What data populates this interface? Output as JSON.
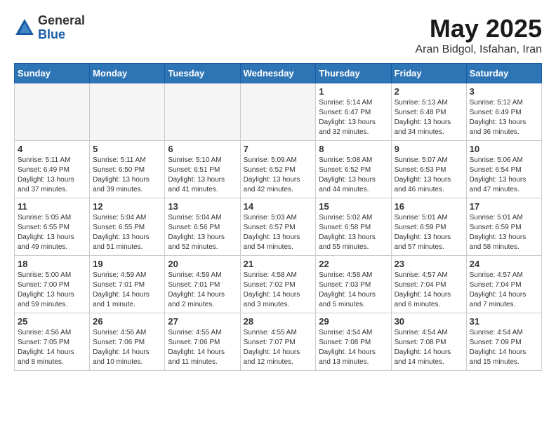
{
  "header": {
    "logo_general": "General",
    "logo_blue": "Blue",
    "title": "May 2025",
    "location": "Aran Bidgol, Isfahan, Iran"
  },
  "weekdays": [
    "Sunday",
    "Monday",
    "Tuesday",
    "Wednesday",
    "Thursday",
    "Friday",
    "Saturday"
  ],
  "weeks": [
    [
      {
        "day": "",
        "info": ""
      },
      {
        "day": "",
        "info": ""
      },
      {
        "day": "",
        "info": ""
      },
      {
        "day": "",
        "info": ""
      },
      {
        "day": "1",
        "info": "Sunrise: 5:14 AM\nSunset: 6:47 PM\nDaylight: 13 hours\nand 32 minutes."
      },
      {
        "day": "2",
        "info": "Sunrise: 5:13 AM\nSunset: 6:48 PM\nDaylight: 13 hours\nand 34 minutes."
      },
      {
        "day": "3",
        "info": "Sunrise: 5:12 AM\nSunset: 6:49 PM\nDaylight: 13 hours\nand 36 minutes."
      }
    ],
    [
      {
        "day": "4",
        "info": "Sunrise: 5:11 AM\nSunset: 6:49 PM\nDaylight: 13 hours\nand 37 minutes."
      },
      {
        "day": "5",
        "info": "Sunrise: 5:11 AM\nSunset: 6:50 PM\nDaylight: 13 hours\nand 39 minutes."
      },
      {
        "day": "6",
        "info": "Sunrise: 5:10 AM\nSunset: 6:51 PM\nDaylight: 13 hours\nand 41 minutes."
      },
      {
        "day": "7",
        "info": "Sunrise: 5:09 AM\nSunset: 6:52 PM\nDaylight: 13 hours\nand 42 minutes."
      },
      {
        "day": "8",
        "info": "Sunrise: 5:08 AM\nSunset: 6:52 PM\nDaylight: 13 hours\nand 44 minutes."
      },
      {
        "day": "9",
        "info": "Sunrise: 5:07 AM\nSunset: 6:53 PM\nDaylight: 13 hours\nand 46 minutes."
      },
      {
        "day": "10",
        "info": "Sunrise: 5:06 AM\nSunset: 6:54 PM\nDaylight: 13 hours\nand 47 minutes."
      }
    ],
    [
      {
        "day": "11",
        "info": "Sunrise: 5:05 AM\nSunset: 6:55 PM\nDaylight: 13 hours\nand 49 minutes."
      },
      {
        "day": "12",
        "info": "Sunrise: 5:04 AM\nSunset: 6:55 PM\nDaylight: 13 hours\nand 51 minutes."
      },
      {
        "day": "13",
        "info": "Sunrise: 5:04 AM\nSunset: 6:56 PM\nDaylight: 13 hours\nand 52 minutes."
      },
      {
        "day": "14",
        "info": "Sunrise: 5:03 AM\nSunset: 6:57 PM\nDaylight: 13 hours\nand 54 minutes."
      },
      {
        "day": "15",
        "info": "Sunrise: 5:02 AM\nSunset: 6:58 PM\nDaylight: 13 hours\nand 55 minutes."
      },
      {
        "day": "16",
        "info": "Sunrise: 5:01 AM\nSunset: 6:59 PM\nDaylight: 13 hours\nand 57 minutes."
      },
      {
        "day": "17",
        "info": "Sunrise: 5:01 AM\nSunset: 6:59 PM\nDaylight: 13 hours\nand 58 minutes."
      }
    ],
    [
      {
        "day": "18",
        "info": "Sunrise: 5:00 AM\nSunset: 7:00 PM\nDaylight: 13 hours\nand 59 minutes."
      },
      {
        "day": "19",
        "info": "Sunrise: 4:59 AM\nSunset: 7:01 PM\nDaylight: 14 hours\nand 1 minute."
      },
      {
        "day": "20",
        "info": "Sunrise: 4:59 AM\nSunset: 7:01 PM\nDaylight: 14 hours\nand 2 minutes."
      },
      {
        "day": "21",
        "info": "Sunrise: 4:58 AM\nSunset: 7:02 PM\nDaylight: 14 hours\nand 3 minutes."
      },
      {
        "day": "22",
        "info": "Sunrise: 4:58 AM\nSunset: 7:03 PM\nDaylight: 14 hours\nand 5 minutes."
      },
      {
        "day": "23",
        "info": "Sunrise: 4:57 AM\nSunset: 7:04 PM\nDaylight: 14 hours\nand 6 minutes."
      },
      {
        "day": "24",
        "info": "Sunrise: 4:57 AM\nSunset: 7:04 PM\nDaylight: 14 hours\nand 7 minutes."
      }
    ],
    [
      {
        "day": "25",
        "info": "Sunrise: 4:56 AM\nSunset: 7:05 PM\nDaylight: 14 hours\nand 8 minutes."
      },
      {
        "day": "26",
        "info": "Sunrise: 4:56 AM\nSunset: 7:06 PM\nDaylight: 14 hours\nand 10 minutes."
      },
      {
        "day": "27",
        "info": "Sunrise: 4:55 AM\nSunset: 7:06 PM\nDaylight: 14 hours\nand 11 minutes."
      },
      {
        "day": "28",
        "info": "Sunrise: 4:55 AM\nSunset: 7:07 PM\nDaylight: 14 hours\nand 12 minutes."
      },
      {
        "day": "29",
        "info": "Sunrise: 4:54 AM\nSunset: 7:08 PM\nDaylight: 14 hours\nand 13 minutes."
      },
      {
        "day": "30",
        "info": "Sunrise: 4:54 AM\nSunset: 7:08 PM\nDaylight: 14 hours\nand 14 minutes."
      },
      {
        "day": "31",
        "info": "Sunrise: 4:54 AM\nSunset: 7:09 PM\nDaylight: 14 hours\nand 15 minutes."
      }
    ]
  ]
}
